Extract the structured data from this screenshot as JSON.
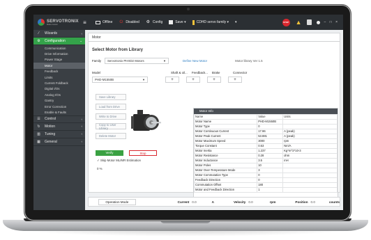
{
  "app": {
    "logo_text": "SERVOTRONIX",
    "logo_sub": "Motion Control"
  },
  "toolbar": {
    "menu_icon": "hamburger-icon",
    "items": [
      {
        "label": "Offline",
        "icon": "monitor-icon"
      },
      {
        "label": "Disabled",
        "icon": "power-icon"
      },
      {
        "label": "Config",
        "icon": "gear-icon"
      },
      {
        "label": "Save ▾",
        "icon": "save-icon"
      },
      {
        "label": "CDHD servo family ▾",
        "icon": "drive-icon"
      }
    ],
    "more": "▾",
    "stop_label": "STOP",
    "window_controls": "– □ ×"
  },
  "sidebar": {
    "sections": [
      {
        "label": "Wizards",
        "icon": "wand-icon",
        "chevron": "‹",
        "active": false
      },
      {
        "label": "Configuration",
        "icon": "gear-icon",
        "chevron": "⌄",
        "active": true
      }
    ],
    "sub_items": [
      {
        "label": "Communication",
        "active": false
      },
      {
        "label": "Drive Information",
        "active": false
      },
      {
        "label": "Power Stage",
        "active": false
      },
      {
        "label": "Motor",
        "active": true
      },
      {
        "label": "Feedback",
        "active": false
      },
      {
        "label": "Limits",
        "active": false
      },
      {
        "label": "Current Foldback",
        "active": false
      },
      {
        "label": "Digital I/Os",
        "active": false
      },
      {
        "label": "Analog I/Os",
        "active": false
      },
      {
        "label": "Gantry",
        "active": false
      },
      {
        "label": "Error Correction",
        "active": false
      },
      {
        "label": "Enable & Faults",
        "active": false
      }
    ],
    "bottom_sections": [
      {
        "label": "Control",
        "icon": "sliders-icon",
        "chevron": "‹"
      },
      {
        "label": "Motion",
        "icon": "motion-icon",
        "chevron": "‹"
      },
      {
        "label": "Tuning",
        "icon": "chart-icon",
        "chevron": "‹"
      },
      {
        "label": "General",
        "icon": "grid-icon",
        "chevron": "‹"
      }
    ]
  },
  "main": {
    "title": "Motor",
    "section_title": "Select Motor from Library",
    "family_label": "Family",
    "family_value": "Servotronix PHXD2 Motors",
    "define_link": "Define New Motor",
    "library_version": "Motor library Ver 1.5",
    "model_label": "Model",
    "model_value": "PHD-M1550B",
    "shaft_label": "Shaft & oil...",
    "feedback_label": "Feedback...",
    "brake_label": "Brake",
    "connector_label": "Connector",
    "stepper_symbol": "+",
    "buttons": [
      "Save Library",
      "Load from Drive",
      "Write to Drive",
      "Copy to User Library",
      "Delete Motor"
    ],
    "verify_label": "Verify",
    "stop_label": "Stop",
    "skip_label": "✓  Skip Motor ML/MR Estimation",
    "progress": "0 %"
  },
  "motor_info": {
    "title": "Motor Info",
    "headers": [
      "Name",
      "Value",
      "Units"
    ],
    "rows": [
      [
        "Motor Name",
        "PHD-M1550B",
        ""
      ],
      [
        "Motor Type",
        "0",
        ""
      ],
      [
        "Motor Continuous Current",
        "17.96",
        "A (peak)"
      ],
      [
        "Motor Peak Current",
        "53.881",
        "A (peak)"
      ],
      [
        "Motor Maximum Speed",
        "3000",
        "rpm"
      ],
      [
        "Torque Constant",
        "0.53",
        "Nm/A"
      ],
      [
        "Motor Inertia",
        "1.237",
        "Kg*m^2*10-3"
      ],
      [
        "Motor Resistance",
        "0.28",
        "ohm"
      ],
      [
        "Motor Inductance",
        "3.5",
        "mH"
      ],
      [
        "Motor Poles",
        "10",
        ""
      ],
      [
        "Motor Over-Temperature Mode",
        "3",
        ""
      ],
      [
        "Motor Commutation Type",
        "0",
        ""
      ],
      [
        "Feedback Direction",
        "0",
        ""
      ],
      [
        "Commutation Offset",
        "180",
        ""
      ],
      [
        "Motor and Feedback Direction",
        "1",
        ""
      ]
    ]
  },
  "status": {
    "operation_mode": "Operation Mode",
    "current_label": "Current",
    "current_value": "0.0",
    "current_unit": "A",
    "velocity_label": "Velocity",
    "velocity_value": "0.0",
    "velocity_unit": "rpm",
    "position_label": "Position",
    "position_value": "0.0",
    "position_unit": "counts"
  }
}
